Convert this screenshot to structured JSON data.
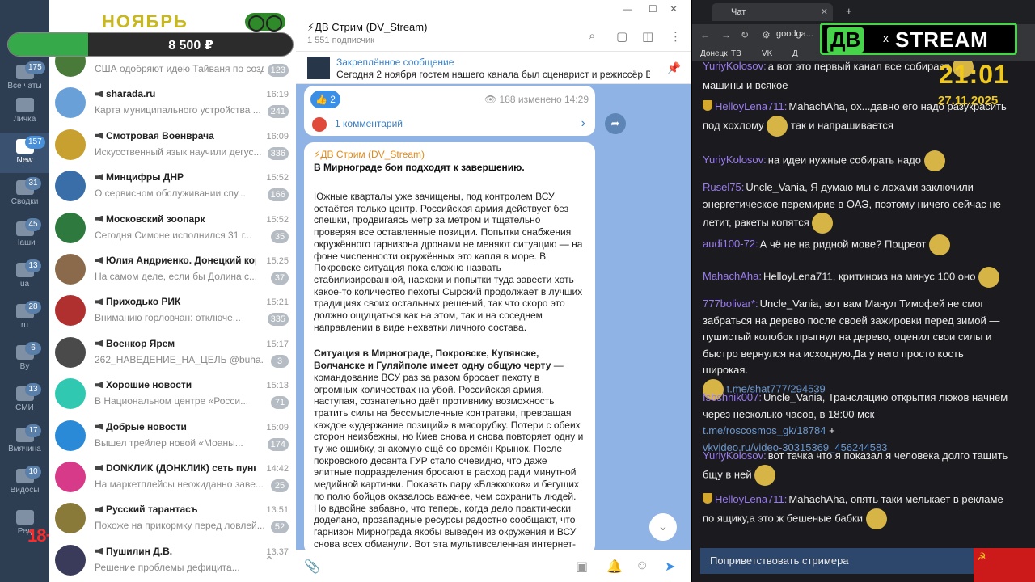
{
  "telegram": {
    "nav": [
      {
        "label": "Все чаты",
        "badge": "175",
        "icon": "chat-bubbles-icon"
      },
      {
        "label": "Личка",
        "badge": "",
        "icon": "folder-icon"
      },
      {
        "label": "New",
        "badge": "157",
        "icon": "folder-icon"
      },
      {
        "label": "Сводки",
        "badge": "31",
        "icon": "folder-icon"
      },
      {
        "label": "Наши",
        "badge": "45",
        "icon": "folder-icon"
      },
      {
        "label": "ua",
        "badge": "13",
        "icon": "folder-icon"
      },
      {
        "label": "ru",
        "badge": "28",
        "icon": "folder-icon"
      },
      {
        "label": "By",
        "badge": "6",
        "icon": "folder-icon"
      },
      {
        "label": "СМИ",
        "badge": "13",
        "icon": "folder-icon"
      },
      {
        "label": "Вмячина",
        "badge": "17",
        "icon": "folder-icon"
      },
      {
        "label": "Видосы",
        "badge": "10",
        "icon": "folder-icon"
      },
      {
        "label": "Ред",
        "badge": "",
        "icon": "edit-icon"
      }
    ],
    "age_mark": "18+",
    "overlay": {
      "month": "НОЯБРЬ",
      "balance": "8 500 ₽",
      "progress": 0.28
    },
    "chats": [
      {
        "title": "",
        "time": "",
        "preview": "США одобряют идею Тайваня по созд...",
        "badge": "123",
        "color": "#4a7a3a"
      },
      {
        "title": "sharada.ru",
        "time": "16:19",
        "preview": "Карта муниципального устройства ...",
        "badge": "241",
        "color": "#6aa0d8"
      },
      {
        "title": "Смотровая Военврача",
        "time": "16:09",
        "preview": "Искусственный язык научили дегус...",
        "badge": "336",
        "color": "#c8a030"
      },
      {
        "title": "Минцифры ДНР",
        "time": "15:52",
        "preview": "О сервисном обслуживании спу...",
        "badge": "166",
        "color": "#3a6ea8"
      },
      {
        "title": "Московский зоопарк",
        "time": "15:52",
        "preview": "Сегодня Симоне исполнился 31 г...",
        "badge": "35",
        "color": "#2e7a3e"
      },
      {
        "title": "Юлия Андриенко. Донецкий корр...",
        "time": "15:25",
        "preview": "На самом деле, если бы Долина с...",
        "badge": "37",
        "color": "#8a6a4a"
      },
      {
        "title": "Приходько РИК",
        "time": "15:21",
        "preview": "Вниманию горловчан: отключе...",
        "badge": "335",
        "color": "#b03030"
      },
      {
        "title": "Военкор Ярем",
        "time": "15:17",
        "preview": "262_НАВЕДЕНИЕ_НА_ЦЕЛЬ @buha...",
        "badge": "3",
        "color": "#4a4a4a"
      },
      {
        "title": "Хорошие новости",
        "time": "15:13",
        "preview": "В Национальном центре «Росси...",
        "badge": "71",
        "color": "#30c8b0"
      },
      {
        "title": "Добрые новости",
        "time": "15:09",
        "preview": "Вышел трейлер новой «Моаны...",
        "badge": "174",
        "color": "#2a8ad8"
      },
      {
        "title": "DONКЛИК (ДОНКЛИК) сеть пункто...",
        "time": "14:42",
        "preview": "На маркетплейсы неожиданно заве...",
        "badge": "25",
        "color": "#d83a8a"
      },
      {
        "title": "Русский тарантасъ",
        "time": "13:51",
        "preview": "Похоже на прикормку перед ловлей...",
        "badge": "52",
        "color": "#8a7a3a"
      },
      {
        "title": "Пушилин Д.В.",
        "time": "13:37",
        "preview": "Решение проблемы дефицита...",
        "badge": "",
        "color": "#3a3a5a"
      }
    ],
    "channel": {
      "title": "⚡ДВ Стрим (DV_Stream)",
      "subscribers": "1 551 подписчик",
      "pinned_label": "Закреплённое сообщение",
      "pinned_text": "Сегодня 2 ноября гостем нашего канала был сценарист и режиссёр Вла...",
      "reaction": "👍 2",
      "views": "👁 188   изменено 14:29",
      "comments": "1 комментарий",
      "post_from": "⚡ДВ Стрим (DV_Stream)",
      "post_heading": "В Мирнограде бои подходят к завершению.",
      "post_p1": "Южные кварталы уже зачищены, под контролем ВСУ остаётся только центр. Российская армия действует без спешки, продвигаясь метр за метром и тщательно проверяя все оставленные позиции. Попытки снабжения окружённого гарнизона дронами не меняют ситуацию — на фоне численности окружённых это капля в море. В Покровске ситуация пока сложно назвать стабилизированной, наскоки и попытки туда завести хоть какое-то количество пехоты Сырский продолжает в лучших традициях своих остальных решений, так что скоро это должно ощущаться как на этом, так и на соседнем направлении в виде нехватки личного состава.",
      "post_p2_bold": "Ситуация в Мирнограде, Покровске, Купянске, Волчанске и Гуляйполе имеет одну общую черту",
      "post_p2": " — командование ВСУ раз за разом бросает пехоту в огромных количествах на убой. Российская армия, наступая, сознательно даёт противнику возможность тратить силы на бессмысленные контратаки, превращая каждое «удержание позиций» в мясорубку. Потери с обеих сторон неизбежны, но Киев снова и снова повторяет одну и ту же ошибку, знакомую ещё со времён Крынок. После покровского десанта ГУР стало очевидно, что даже элитные подразделения бросают в расход ради минутной медийной картинки. Показать пару «Блэкхоков» и бегущих по полю бойцов оказалось важнее, чем сохранить людей. Но вдвойне забавно, что теперь, когда дело практически доделано, прозападные ресурсы радостно сообщают, что гарнизон Мирнограда якобы выведен из окружения и ВСУ снова всех обманули. Вот эта мультивселенная интернет-безумия, которую породил сначала Залужный, а потом активно подхватил Сырский, и является главной проблемой украинской армии"
    }
  },
  "browser": {
    "tab_title": "Чат",
    "url": "goodga...",
    "bookmarks": [
      "Донецк",
      "ТВ",
      "VK",
      "Д"
    ],
    "logo_dv": "ДВ",
    "logo_x": "x",
    "logo_stream": "STREAM",
    "clock": "21:01",
    "date": "27.11.2025",
    "messages": [
      {
        "nick": "YuriyKolosov:",
        "text": "а вот это первый канал все собирает",
        "text2": "машины и всякое",
        "color": "#9b7cf0"
      },
      {
        "nick": "HelloyLena711:",
        "text": "MahachAha, ох...давно его надо разукрасить под хохлому",
        "text2": "так и напрашивается",
        "color": "#9b7cf0"
      },
      {
        "nick": "YuriyKolosov:",
        "text": "на идеи нужные собирать надо",
        "text2": "",
        "color": "#9b7cf0"
      },
      {
        "nick": "Rusel75:",
        "text": "Uncle_Vania, Я думаю мы с лохами заключили энергетическое перемирие в ОАЭ, поэтому ничего сейчас не летит, ракеты копятся",
        "text2": "",
        "color": "#9b7cf0"
      },
      {
        "nick": "audi100-72:",
        "text": "А чё не на ридной мове? Поцреот",
        "text2": "",
        "color": "#9b7cf0"
      },
      {
        "nick": "MahachAha:",
        "text": "HelloyLena711, критиноиз на минус 100 оно",
        "text2": "",
        "color": "#9b7cf0"
      },
      {
        "nick": "777bolivar*:",
        "text": "Uncle_Vania, вот вам Манул Тимофей не смог забраться на дерево после своей зажировки перед зимой — пушистый колобок прыгнул на дерево, оценил свои силы и быстро вернулся на исходную.Да у него просто кость широкая.",
        "link": "t.me/shat777/294539",
        "color": "#9b7cf0"
      },
      {
        "nick": "fsbshnik007:",
        "text": "Uncle_Vania, Трансляцию открытия люков начнём через несколько часов, в 18:00 мск",
        "link": "t.me/roscosmos_gk/18784",
        "link_tail": " +",
        "link2": "vkvideo.ru/video-30315369_456244583",
        "color": "#9b7cf0"
      },
      {
        "nick": "YuriyKolosov:",
        "text": "вот тачка что я показал я человека долго тащить бщу в ней",
        "text2": "",
        "color": "#9b7cf0"
      },
      {
        "nick": "HelloyLena711:",
        "text": "MahachAha, опять таки мелькает в рекламе по ящику,а это ж бешеные бабки",
        "text2": "",
        "color": "#9b7cf0"
      }
    ],
    "greet_button": "Поприветствовать стримера",
    "flag_symbol": "☭"
  }
}
